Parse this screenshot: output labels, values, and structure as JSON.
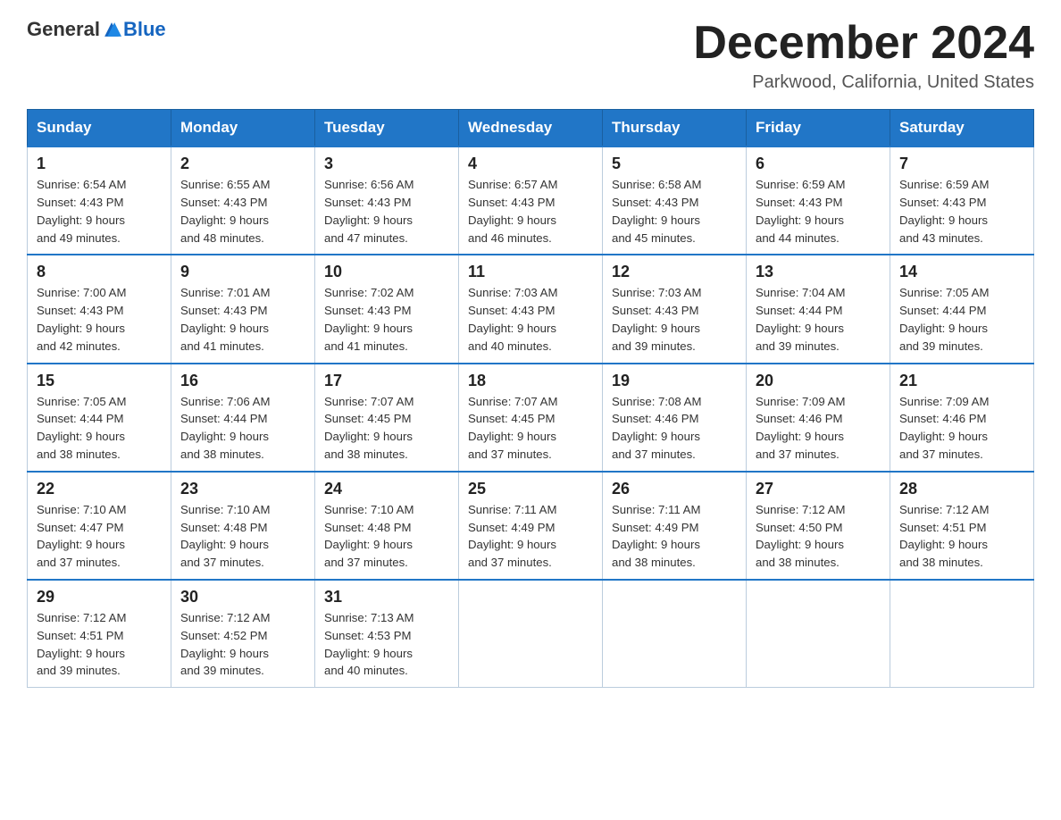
{
  "logo": {
    "general": "General",
    "blue": "Blue"
  },
  "title": "December 2024",
  "location": "Parkwood, California, United States",
  "days_of_week": [
    "Sunday",
    "Monday",
    "Tuesday",
    "Wednesday",
    "Thursday",
    "Friday",
    "Saturday"
  ],
  "weeks": [
    [
      {
        "day": "1",
        "sunrise": "6:54 AM",
        "sunset": "4:43 PM",
        "daylight": "9 hours and 49 minutes."
      },
      {
        "day": "2",
        "sunrise": "6:55 AM",
        "sunset": "4:43 PM",
        "daylight": "9 hours and 48 minutes."
      },
      {
        "day": "3",
        "sunrise": "6:56 AM",
        "sunset": "4:43 PM",
        "daylight": "9 hours and 47 minutes."
      },
      {
        "day": "4",
        "sunrise": "6:57 AM",
        "sunset": "4:43 PM",
        "daylight": "9 hours and 46 minutes."
      },
      {
        "day": "5",
        "sunrise": "6:58 AM",
        "sunset": "4:43 PM",
        "daylight": "9 hours and 45 minutes."
      },
      {
        "day": "6",
        "sunrise": "6:59 AM",
        "sunset": "4:43 PM",
        "daylight": "9 hours and 44 minutes."
      },
      {
        "day": "7",
        "sunrise": "6:59 AM",
        "sunset": "4:43 PM",
        "daylight": "9 hours and 43 minutes."
      }
    ],
    [
      {
        "day": "8",
        "sunrise": "7:00 AM",
        "sunset": "4:43 PM",
        "daylight": "9 hours and 42 minutes."
      },
      {
        "day": "9",
        "sunrise": "7:01 AM",
        "sunset": "4:43 PM",
        "daylight": "9 hours and 41 minutes."
      },
      {
        "day": "10",
        "sunrise": "7:02 AM",
        "sunset": "4:43 PM",
        "daylight": "9 hours and 41 minutes."
      },
      {
        "day": "11",
        "sunrise": "7:03 AM",
        "sunset": "4:43 PM",
        "daylight": "9 hours and 40 minutes."
      },
      {
        "day": "12",
        "sunrise": "7:03 AM",
        "sunset": "4:43 PM",
        "daylight": "9 hours and 39 minutes."
      },
      {
        "day": "13",
        "sunrise": "7:04 AM",
        "sunset": "4:44 PM",
        "daylight": "9 hours and 39 minutes."
      },
      {
        "day": "14",
        "sunrise": "7:05 AM",
        "sunset": "4:44 PM",
        "daylight": "9 hours and 39 minutes."
      }
    ],
    [
      {
        "day": "15",
        "sunrise": "7:05 AM",
        "sunset": "4:44 PM",
        "daylight": "9 hours and 38 minutes."
      },
      {
        "day": "16",
        "sunrise": "7:06 AM",
        "sunset": "4:44 PM",
        "daylight": "9 hours and 38 minutes."
      },
      {
        "day": "17",
        "sunrise": "7:07 AM",
        "sunset": "4:45 PM",
        "daylight": "9 hours and 38 minutes."
      },
      {
        "day": "18",
        "sunrise": "7:07 AM",
        "sunset": "4:45 PM",
        "daylight": "9 hours and 37 minutes."
      },
      {
        "day": "19",
        "sunrise": "7:08 AM",
        "sunset": "4:46 PM",
        "daylight": "9 hours and 37 minutes."
      },
      {
        "day": "20",
        "sunrise": "7:09 AM",
        "sunset": "4:46 PM",
        "daylight": "9 hours and 37 minutes."
      },
      {
        "day": "21",
        "sunrise": "7:09 AM",
        "sunset": "4:46 PM",
        "daylight": "9 hours and 37 minutes."
      }
    ],
    [
      {
        "day": "22",
        "sunrise": "7:10 AM",
        "sunset": "4:47 PM",
        "daylight": "9 hours and 37 minutes."
      },
      {
        "day": "23",
        "sunrise": "7:10 AM",
        "sunset": "4:48 PM",
        "daylight": "9 hours and 37 minutes."
      },
      {
        "day": "24",
        "sunrise": "7:10 AM",
        "sunset": "4:48 PM",
        "daylight": "9 hours and 37 minutes."
      },
      {
        "day": "25",
        "sunrise": "7:11 AM",
        "sunset": "4:49 PM",
        "daylight": "9 hours and 37 minutes."
      },
      {
        "day": "26",
        "sunrise": "7:11 AM",
        "sunset": "4:49 PM",
        "daylight": "9 hours and 38 minutes."
      },
      {
        "day": "27",
        "sunrise": "7:12 AM",
        "sunset": "4:50 PM",
        "daylight": "9 hours and 38 minutes."
      },
      {
        "day": "28",
        "sunrise": "7:12 AM",
        "sunset": "4:51 PM",
        "daylight": "9 hours and 38 minutes."
      }
    ],
    [
      {
        "day": "29",
        "sunrise": "7:12 AM",
        "sunset": "4:51 PM",
        "daylight": "9 hours and 39 minutes."
      },
      {
        "day": "30",
        "sunrise": "7:12 AM",
        "sunset": "4:52 PM",
        "daylight": "9 hours and 39 minutes."
      },
      {
        "day": "31",
        "sunrise": "7:13 AM",
        "sunset": "4:53 PM",
        "daylight": "9 hours and 40 minutes."
      },
      null,
      null,
      null,
      null
    ]
  ],
  "labels": {
    "sunrise": "Sunrise:",
    "sunset": "Sunset:",
    "daylight": "Daylight:"
  }
}
